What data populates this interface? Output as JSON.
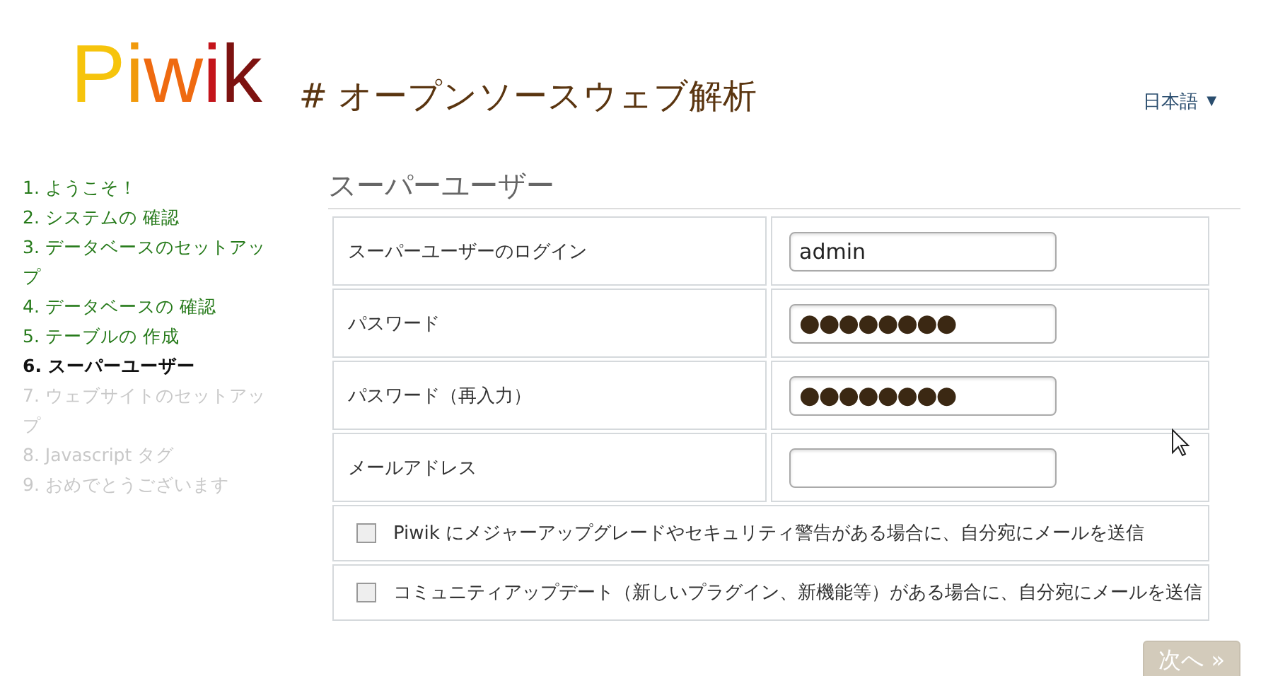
{
  "logo": {
    "text": "Piwik"
  },
  "tagline": "# オープンソースウェブ解析",
  "language": {
    "label": "日本語",
    "caret": "▼"
  },
  "steps": [
    {
      "label": "1. ようこそ！",
      "completed": true,
      "selected": false
    },
    {
      "label": "2. システムの 確認",
      "completed": true,
      "selected": false
    },
    {
      "label": "3. データベースのセットアップ",
      "completed": true,
      "selected": false
    },
    {
      "label": "4. データベースの 確認",
      "completed": true,
      "selected": false
    },
    {
      "label": "5. テーブルの 作成",
      "completed": true,
      "selected": false
    },
    {
      "label": "6. スーパーユーザー",
      "completed": false,
      "selected": true
    },
    {
      "label": "7. ウェブサイトのセットアップ",
      "completed": false,
      "selected": false
    },
    {
      "label": "8. Javascript タグ",
      "completed": false,
      "selected": false
    },
    {
      "label": "9. おめでとうございます",
      "completed": false,
      "selected": false
    }
  ],
  "section_title": "スーパーユーザー",
  "fields": [
    {
      "label": "スーパーユーザーのログイン",
      "value": "admin",
      "kind": "text"
    },
    {
      "label": "パスワード",
      "value": "●●●●●●●●",
      "kind": "password"
    },
    {
      "label": "パスワード（再入力）",
      "value": "●●●●●●●●",
      "kind": "password"
    },
    {
      "label": "メールアドレス",
      "kind": "text"
    }
  ],
  "options": [
    {
      "label": "Piwik にメジャーアップグレードやセキュリティ警告がある場合に、自分宛にメールを送信",
      "checked": false
    },
    {
      "label": "コミュニティアップデート（新しいプラグイン、新機能等）がある場合に、自分宛にメールを送信",
      "checked": false
    }
  ],
  "next_button": {
    "label": "次へ »",
    "disabled": true
  }
}
